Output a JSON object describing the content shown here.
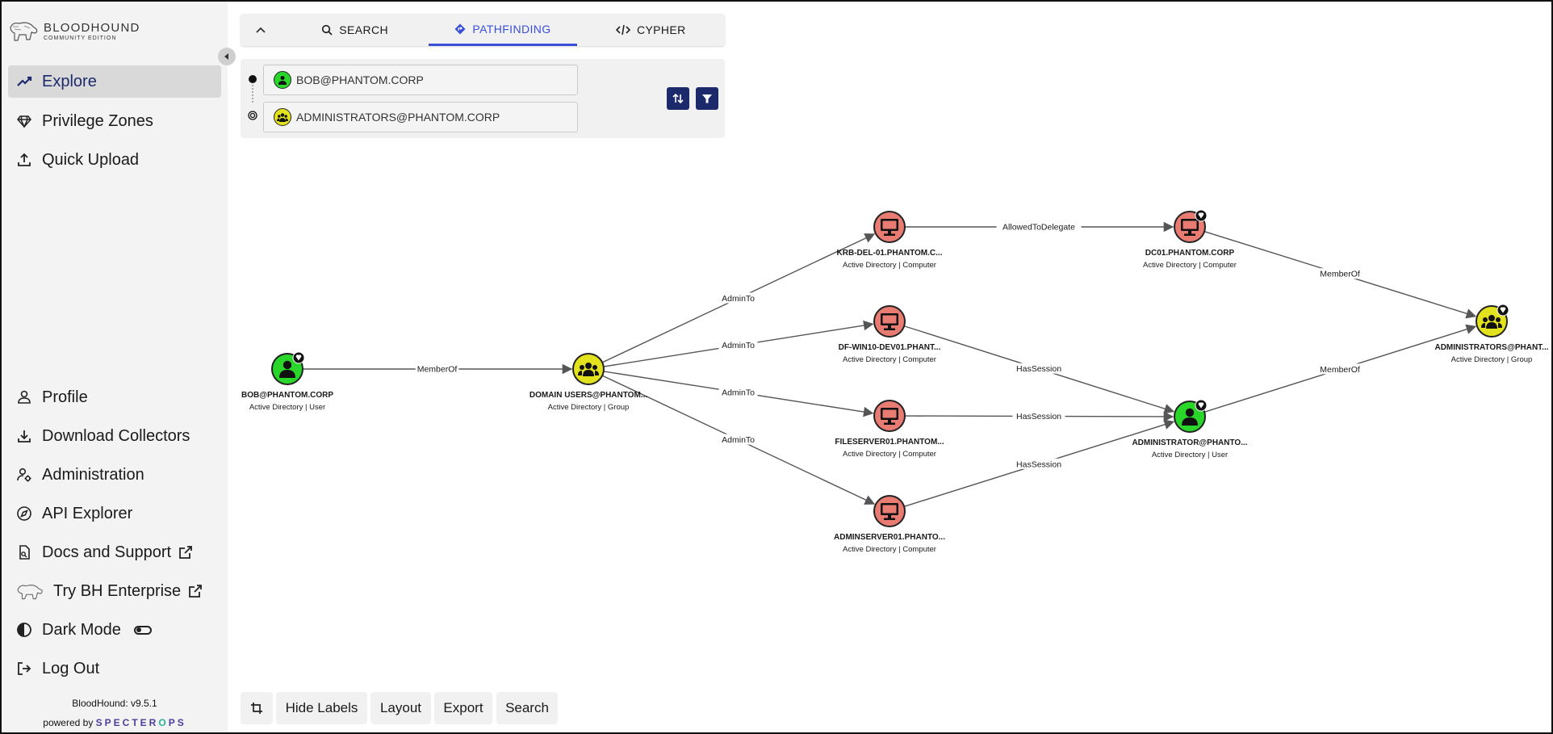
{
  "app": {
    "logo_main": "BLOODHOUND",
    "logo_sub": "COMMUNITY EDITION",
    "version": "BloodHound: v9.5.1",
    "powered_by": "powered by",
    "powered_brand": "SPECTER",
    "powered_brand_o": "O",
    "powered_brand_end": "PS"
  },
  "sidebar": {
    "top_items": [
      {
        "label": "Explore",
        "icon": "trend-icon",
        "active": true
      },
      {
        "label": "Privilege Zones",
        "icon": "gem-icon"
      },
      {
        "label": "Quick Upload",
        "icon": "upload-icon"
      }
    ],
    "bottom_items": [
      {
        "label": "Profile",
        "icon": "person-icon"
      },
      {
        "label": "Download Collectors",
        "icon": "download-icon"
      },
      {
        "label": "Administration",
        "icon": "user-gear-icon"
      },
      {
        "label": "API Explorer",
        "icon": "compass-icon"
      },
      {
        "label": "Docs and Support",
        "icon": "docs-icon",
        "external": true
      },
      {
        "label": "Try BH Enterprise",
        "icon": "bloodhound-logo-icon",
        "external": true
      },
      {
        "label": "Dark Mode",
        "icon": "contrast-icon",
        "toggle": false
      },
      {
        "label": "Log Out",
        "icon": "logout-icon"
      }
    ]
  },
  "search": {
    "tabs": [
      {
        "label": "SEARCH",
        "icon": "search-icon"
      },
      {
        "label": "PATHFINDING",
        "icon": "diamond-directions-icon",
        "active": true
      },
      {
        "label": "CYPHER",
        "icon": "code-icon"
      }
    ],
    "source": "BOB@PHANTOM.CORP",
    "destination": "ADMINISTRATORS@PHANTOM.CORP"
  },
  "toolbar": {
    "hide_labels": "Hide Labels",
    "layout": "Layout",
    "export": "Export",
    "search": "Search"
  },
  "graph": {
    "colors": {
      "user": "#2bd62b",
      "group": "#e2e21f",
      "computer": "#e87b72"
    },
    "nodes": [
      {
        "id": "bob",
        "label": "BOB@PHANTOM.CORP",
        "sub": "Active Directory | User",
        "type": "user",
        "badge": true
      },
      {
        "id": "du",
        "label": "DOMAIN USERS@PHANTOM...",
        "sub": "Active Directory | Group",
        "type": "group",
        "badge": false
      },
      {
        "id": "krb",
        "label": "KRB-DEL-01.PHANTOM.C...",
        "sub": "Active Directory | Computer",
        "type": "computer",
        "badge": false
      },
      {
        "id": "dfw",
        "label": "DF-WIN10-DEV01.PHANT...",
        "sub": "Active Directory | Computer",
        "type": "computer",
        "badge": false
      },
      {
        "id": "fs",
        "label": "FILESERVER01.PHANTOM...",
        "sub": "Active Directory | Computer",
        "type": "computer",
        "badge": false
      },
      {
        "id": "as",
        "label": "ADMINSERVER01.PHANTO...",
        "sub": "Active Directory | Computer",
        "type": "computer",
        "badge": false
      },
      {
        "id": "dc",
        "label": "DC01.PHANTOM.CORP",
        "sub": "Active Directory | Computer",
        "type": "computer",
        "badge": true
      },
      {
        "id": "adm",
        "label": "ADMINISTRATOR@PHANTO...",
        "sub": "Active Directory | User",
        "type": "user",
        "badge": true
      },
      {
        "id": "admins",
        "label": "ADMINISTRATORS@PHANT...",
        "sub": "Active Directory | Group",
        "type": "group",
        "badge": true
      }
    ],
    "edges": [
      {
        "from": "bob",
        "to": "du",
        "label": "MemberOf"
      },
      {
        "from": "du",
        "to": "krb",
        "label": "AdminTo"
      },
      {
        "from": "du",
        "to": "dfw",
        "label": "AdminTo"
      },
      {
        "from": "du",
        "to": "fs",
        "label": "AdminTo"
      },
      {
        "from": "du",
        "to": "as",
        "label": "AdminTo"
      },
      {
        "from": "krb",
        "to": "dc",
        "label": "AllowedToDelegate"
      },
      {
        "from": "dfw",
        "to": "adm",
        "label": "HasSession"
      },
      {
        "from": "fs",
        "to": "adm",
        "label": "HasSession"
      },
      {
        "from": "as",
        "to": "adm",
        "label": "HasSession"
      },
      {
        "from": "dc",
        "to": "admins",
        "label": "MemberOf"
      },
      {
        "from": "adm",
        "to": "admins",
        "label": "MemberOf"
      }
    ]
  }
}
